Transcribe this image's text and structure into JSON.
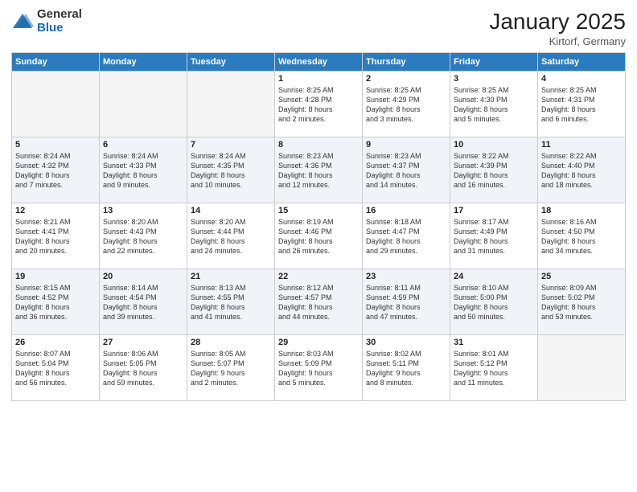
{
  "logo": {
    "general": "General",
    "blue": "Blue"
  },
  "title": "January 2025",
  "subtitle": "Kirtorf, Germany",
  "days": [
    "Sunday",
    "Monday",
    "Tuesday",
    "Wednesday",
    "Thursday",
    "Friday",
    "Saturday"
  ],
  "weeks": [
    [
      {
        "day": "",
        "lines": []
      },
      {
        "day": "",
        "lines": []
      },
      {
        "day": "",
        "lines": []
      },
      {
        "day": "1",
        "lines": [
          "Sunrise: 8:25 AM",
          "Sunset: 4:28 PM",
          "Daylight: 8 hours",
          "and 2 minutes."
        ]
      },
      {
        "day": "2",
        "lines": [
          "Sunrise: 8:25 AM",
          "Sunset: 4:29 PM",
          "Daylight: 8 hours",
          "and 3 minutes."
        ]
      },
      {
        "day": "3",
        "lines": [
          "Sunrise: 8:25 AM",
          "Sunset: 4:30 PM",
          "Daylight: 8 hours",
          "and 5 minutes."
        ]
      },
      {
        "day": "4",
        "lines": [
          "Sunrise: 8:25 AM",
          "Sunset: 4:31 PM",
          "Daylight: 8 hours",
          "and 6 minutes."
        ]
      }
    ],
    [
      {
        "day": "5",
        "lines": [
          "Sunrise: 8:24 AM",
          "Sunset: 4:32 PM",
          "Daylight: 8 hours",
          "and 7 minutes."
        ]
      },
      {
        "day": "6",
        "lines": [
          "Sunrise: 8:24 AM",
          "Sunset: 4:33 PM",
          "Daylight: 8 hours",
          "and 9 minutes."
        ]
      },
      {
        "day": "7",
        "lines": [
          "Sunrise: 8:24 AM",
          "Sunset: 4:35 PM",
          "Daylight: 8 hours",
          "and 10 minutes."
        ]
      },
      {
        "day": "8",
        "lines": [
          "Sunrise: 8:23 AM",
          "Sunset: 4:36 PM",
          "Daylight: 8 hours",
          "and 12 minutes."
        ]
      },
      {
        "day": "9",
        "lines": [
          "Sunrise: 8:23 AM",
          "Sunset: 4:37 PM",
          "Daylight: 8 hours",
          "and 14 minutes."
        ]
      },
      {
        "day": "10",
        "lines": [
          "Sunrise: 8:22 AM",
          "Sunset: 4:39 PM",
          "Daylight: 8 hours",
          "and 16 minutes."
        ]
      },
      {
        "day": "11",
        "lines": [
          "Sunrise: 8:22 AM",
          "Sunset: 4:40 PM",
          "Daylight: 8 hours",
          "and 18 minutes."
        ]
      }
    ],
    [
      {
        "day": "12",
        "lines": [
          "Sunrise: 8:21 AM",
          "Sunset: 4:41 PM",
          "Daylight: 8 hours",
          "and 20 minutes."
        ]
      },
      {
        "day": "13",
        "lines": [
          "Sunrise: 8:20 AM",
          "Sunset: 4:43 PM",
          "Daylight: 8 hours",
          "and 22 minutes."
        ]
      },
      {
        "day": "14",
        "lines": [
          "Sunrise: 8:20 AM",
          "Sunset: 4:44 PM",
          "Daylight: 8 hours",
          "and 24 minutes."
        ]
      },
      {
        "day": "15",
        "lines": [
          "Sunrise: 8:19 AM",
          "Sunset: 4:46 PM",
          "Daylight: 8 hours",
          "and 26 minutes."
        ]
      },
      {
        "day": "16",
        "lines": [
          "Sunrise: 8:18 AM",
          "Sunset: 4:47 PM",
          "Daylight: 8 hours",
          "and 29 minutes."
        ]
      },
      {
        "day": "17",
        "lines": [
          "Sunrise: 8:17 AM",
          "Sunset: 4:49 PM",
          "Daylight: 8 hours",
          "and 31 minutes."
        ]
      },
      {
        "day": "18",
        "lines": [
          "Sunrise: 8:16 AM",
          "Sunset: 4:50 PM",
          "Daylight: 8 hours",
          "and 34 minutes."
        ]
      }
    ],
    [
      {
        "day": "19",
        "lines": [
          "Sunrise: 8:15 AM",
          "Sunset: 4:52 PM",
          "Daylight: 8 hours",
          "and 36 minutes."
        ]
      },
      {
        "day": "20",
        "lines": [
          "Sunrise: 8:14 AM",
          "Sunset: 4:54 PM",
          "Daylight: 8 hours",
          "and 39 minutes."
        ]
      },
      {
        "day": "21",
        "lines": [
          "Sunrise: 8:13 AM",
          "Sunset: 4:55 PM",
          "Daylight: 8 hours",
          "and 41 minutes."
        ]
      },
      {
        "day": "22",
        "lines": [
          "Sunrise: 8:12 AM",
          "Sunset: 4:57 PM",
          "Daylight: 8 hours",
          "and 44 minutes."
        ]
      },
      {
        "day": "23",
        "lines": [
          "Sunrise: 8:11 AM",
          "Sunset: 4:59 PM",
          "Daylight: 8 hours",
          "and 47 minutes."
        ]
      },
      {
        "day": "24",
        "lines": [
          "Sunrise: 8:10 AM",
          "Sunset: 5:00 PM",
          "Daylight: 8 hours",
          "and 50 minutes."
        ]
      },
      {
        "day": "25",
        "lines": [
          "Sunrise: 8:09 AM",
          "Sunset: 5:02 PM",
          "Daylight: 8 hours",
          "and 53 minutes."
        ]
      }
    ],
    [
      {
        "day": "26",
        "lines": [
          "Sunrise: 8:07 AM",
          "Sunset: 5:04 PM",
          "Daylight: 8 hours",
          "and 56 minutes."
        ]
      },
      {
        "day": "27",
        "lines": [
          "Sunrise: 8:06 AM",
          "Sunset: 5:05 PM",
          "Daylight: 8 hours",
          "and 59 minutes."
        ]
      },
      {
        "day": "28",
        "lines": [
          "Sunrise: 8:05 AM",
          "Sunset: 5:07 PM",
          "Daylight: 9 hours",
          "and 2 minutes."
        ]
      },
      {
        "day": "29",
        "lines": [
          "Sunrise: 8:03 AM",
          "Sunset: 5:09 PM",
          "Daylight: 9 hours",
          "and 5 minutes."
        ]
      },
      {
        "day": "30",
        "lines": [
          "Sunrise: 8:02 AM",
          "Sunset: 5:11 PM",
          "Daylight: 9 hours",
          "and 8 minutes."
        ]
      },
      {
        "day": "31",
        "lines": [
          "Sunrise: 8:01 AM",
          "Sunset: 5:12 PM",
          "Daylight: 9 hours",
          "and 11 minutes."
        ]
      },
      {
        "day": "",
        "lines": []
      }
    ]
  ]
}
